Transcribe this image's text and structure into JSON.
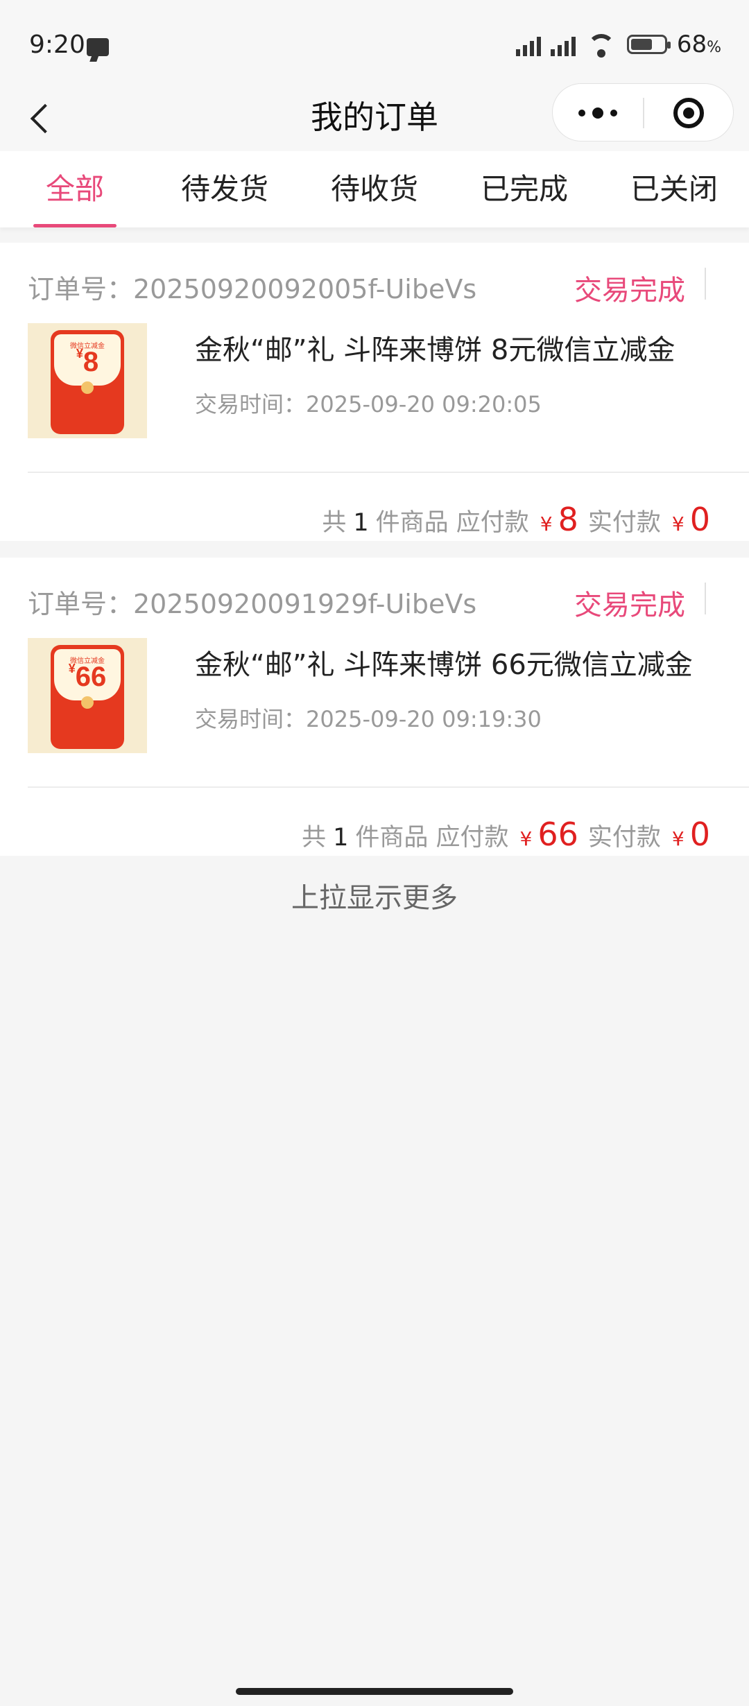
{
  "status_bar": {
    "time": "9:20",
    "battery": "68",
    "battery_unit": "%"
  },
  "nav": {
    "title": "我的订单"
  },
  "tabs": [
    {
      "label": "全部",
      "active": true
    },
    {
      "label": "待发货"
    },
    {
      "label": "待收货"
    },
    {
      "label": "已完成"
    },
    {
      "label": "已关闭"
    }
  ],
  "orders": [
    {
      "order_no": "订单号：20250920092005f-UibeVs",
      "status": "交易完成",
      "thumb_label": "微信立减金",
      "thumb_amount": "8",
      "name": "金秋“邮”礼 斗阵来博饼 8元微信立减金",
      "time": "交易时间：2025-09-20 09:20:05",
      "count_prefix": "共",
      "count": "1",
      "count_suffix": "件商品 应付款",
      "payable": "8",
      "paid_label": "实付款",
      "paid": "0"
    },
    {
      "order_no": "订单号：20250920091929f-UibeVs",
      "status": "交易完成",
      "thumb_label": "微信立减金",
      "thumb_amount": "66",
      "name": "金秋“邮”礼 斗阵来博饼 66元微信立减金",
      "time": "交易时间：2025-09-20 09:19:30",
      "count_prefix": "共",
      "count": "1",
      "count_suffix": "件商品 应付款",
      "payable": "66",
      "paid_label": "实付款",
      "paid": "0"
    }
  ],
  "currency": "¥",
  "load_more": "上拉显示更多",
  "colors": {
    "accent": "#e8497a",
    "price": "#e02020",
    "background": "#f5f5f5"
  }
}
